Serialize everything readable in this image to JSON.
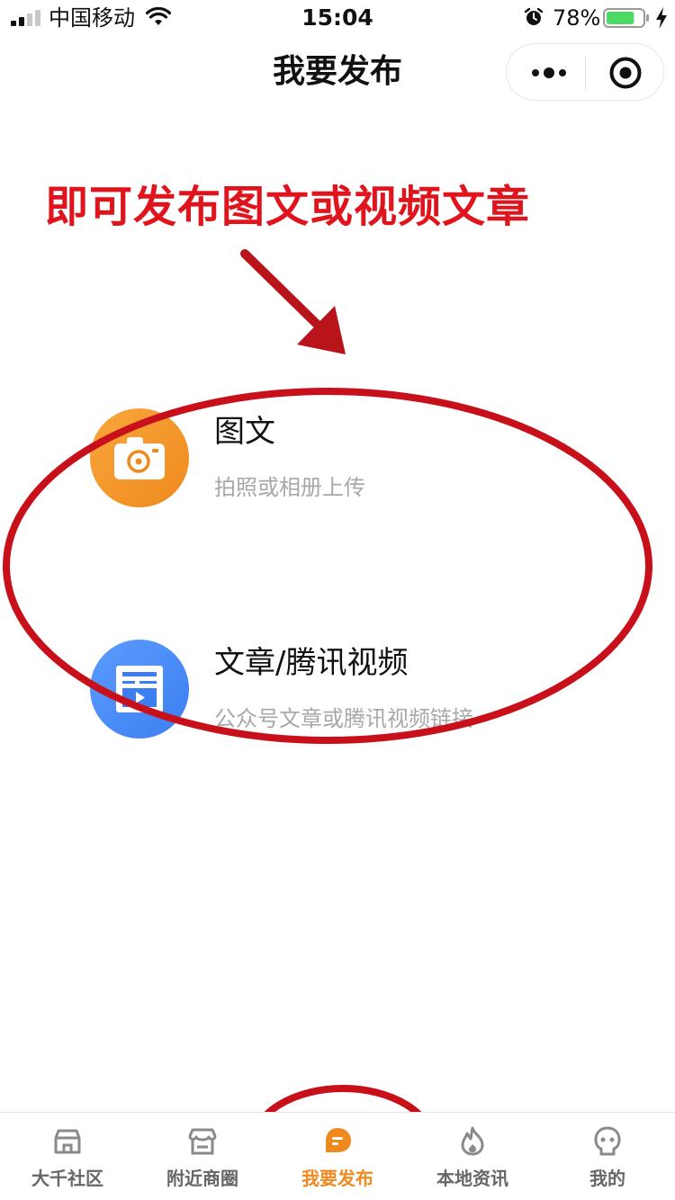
{
  "status_bar": {
    "carrier": "中国移动",
    "time": "15:04",
    "battery_percent": "78%",
    "battery_level": 0.78
  },
  "nav": {
    "title": "我要发布"
  },
  "annotation": {
    "text": "即可发布图文或视频文章",
    "color": "#e0141c"
  },
  "options": [
    {
      "title": "图文",
      "subtitle": "拍照或相册上传",
      "icon": "camera-icon",
      "color": "#f59a2e"
    },
    {
      "title": "文章/腾讯视频",
      "subtitle": "公众号文章或腾讯视频链接",
      "icon": "article-video-icon",
      "color": "#4a8cf7"
    }
  ],
  "tabbar": {
    "active_color": "#f08a1e",
    "items": [
      {
        "label": "大千社区",
        "icon": "community-icon",
        "active": false
      },
      {
        "label": "附近商圈",
        "icon": "store-icon",
        "active": false
      },
      {
        "label": "我要发布",
        "icon": "publish-icon",
        "active": true
      },
      {
        "label": "本地资讯",
        "icon": "flame-icon",
        "active": false
      },
      {
        "label": "我的",
        "icon": "profile-icon",
        "active": false
      }
    ]
  }
}
